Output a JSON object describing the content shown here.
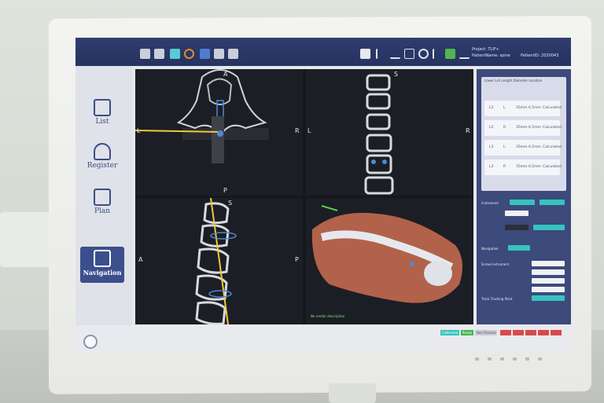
{
  "topbar": {
    "project_label": "Project: TLIF+",
    "patient_label": "PatientName: spine",
    "patient_id": "PatientID: 2020043"
  },
  "nav": {
    "items": [
      {
        "label": "List",
        "icon": "clipboard-icon"
      },
      {
        "label": "Register",
        "icon": "person-icon"
      },
      {
        "label": "Plan",
        "icon": "plan-icon"
      },
      {
        "label": "Navigation",
        "icon": "navigation-icon",
        "active": true
      }
    ]
  },
  "viewports": {
    "axial": {
      "top": "A",
      "bottom": "P",
      "left": "L",
      "right": "R"
    },
    "coronal": {
      "top": "S",
      "left": "L",
      "right": "R"
    },
    "sagittal": {
      "top": "S",
      "left": "A",
      "right": "P"
    },
    "render3d": {
      "note": "No render description"
    }
  },
  "right_panel": {
    "header": "Lower  Lsh   Length  Diameter  Location",
    "rows": [
      {
        "a": "L2",
        "b": "L",
        "c": "35mm",
        "d": "6.5mm",
        "e": "Calculated"
      },
      {
        "a": "L2",
        "b": "R",
        "c": "35mm",
        "d": "6.5mm",
        "e": "Calculated"
      },
      {
        "a": "L3",
        "b": "L",
        "c": "35mm",
        "d": "6.5mm",
        "e": "Calculated"
      },
      {
        "a": "L3",
        "b": "R",
        "c": "35mm",
        "d": "6.5mm",
        "e": "Calculated"
      }
    ],
    "label_instrument": "Instrument",
    "label_navigation": "Navigation",
    "label_screw": "Screw Instrument",
    "label_tracking": "Track Tracking Point"
  },
  "bottombar": {
    "status": [
      "Calibrated",
      "Ready",
      "Non-Tracked"
    ]
  },
  "colors": {
    "accent": "#36c3bf",
    "toolbar": "#2f3c6e",
    "bone_3d": "#b2624a",
    "trajectory": "#f0c93a",
    "alert": "#d84a4a"
  }
}
